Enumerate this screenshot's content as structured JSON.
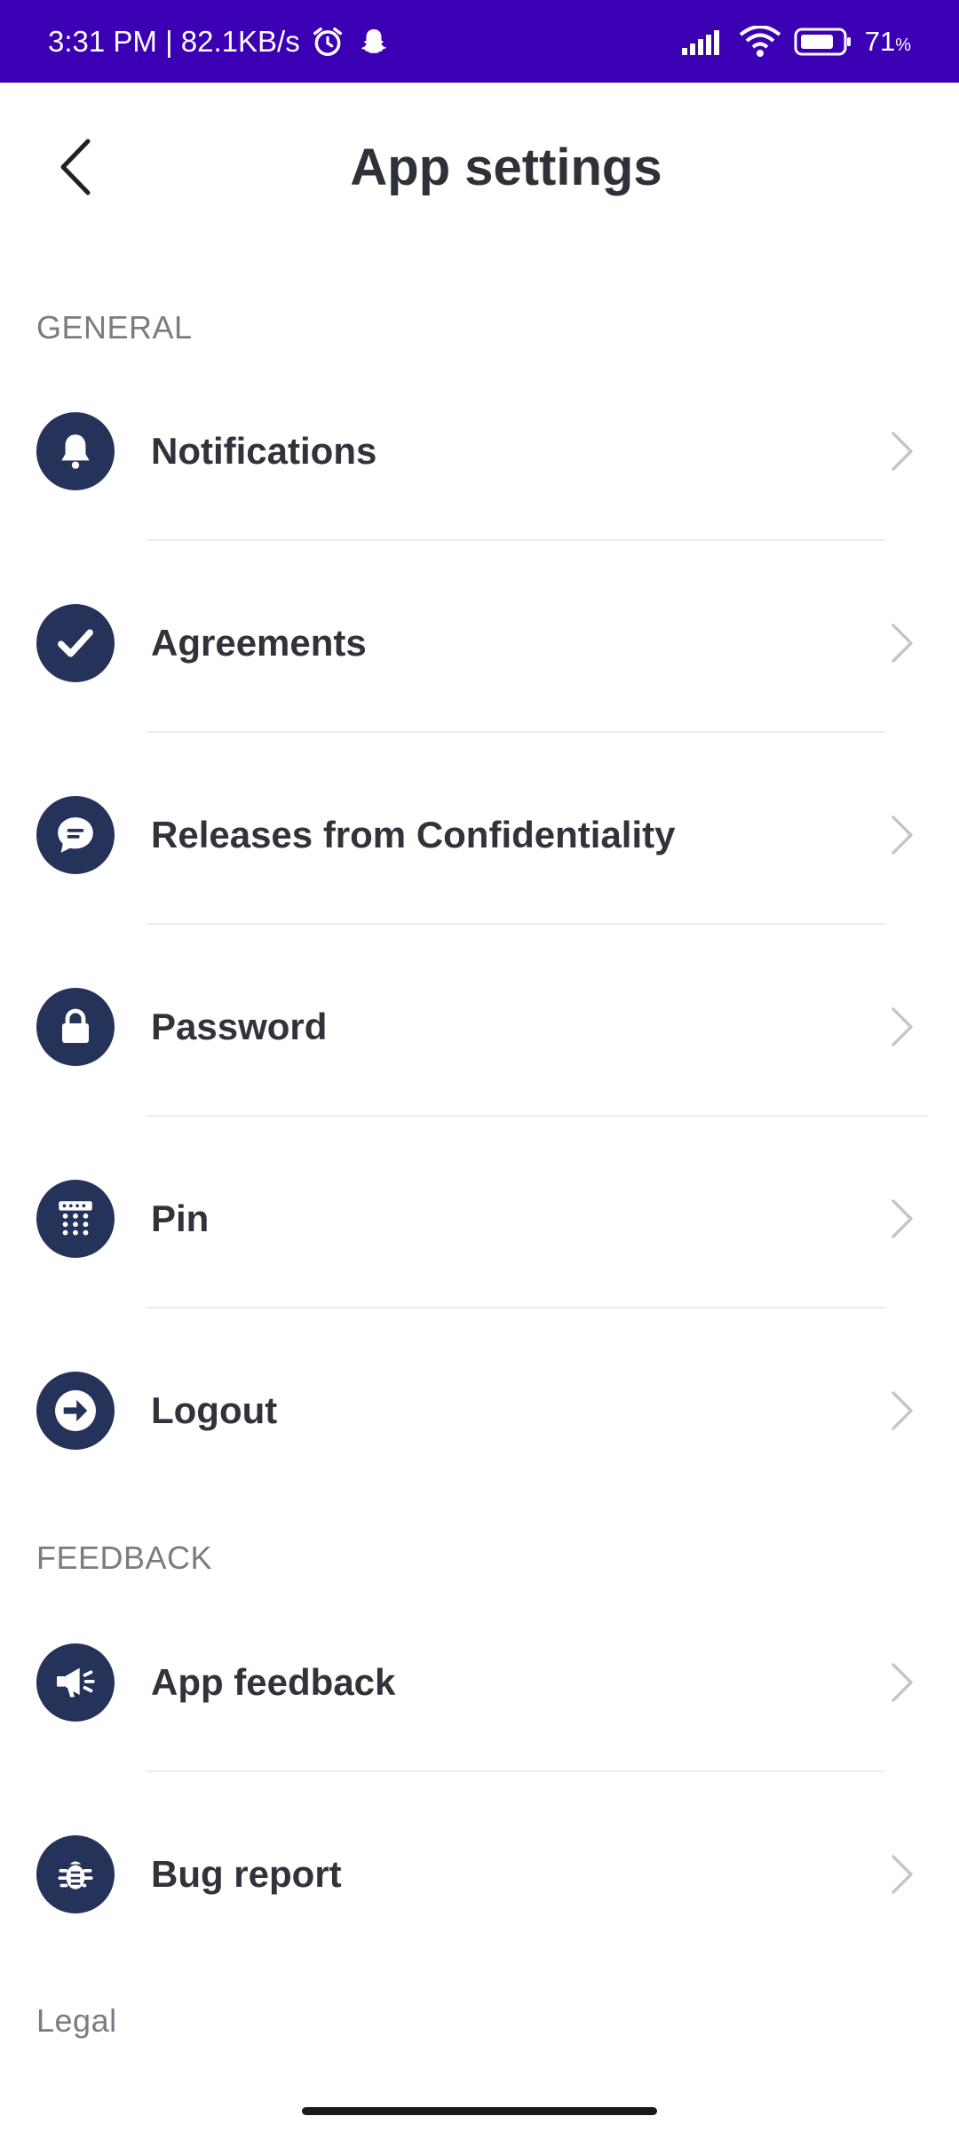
{
  "status_bar": {
    "time_speed": "3:31 PM | 82.1KB/s",
    "icons": [
      "alarm-icon",
      "snapchat-icon",
      "signal-icon",
      "wifi-icon",
      "battery-icon"
    ],
    "battery": "71",
    "battery_unit": "%",
    "background": "#3b00b4"
  },
  "header": {
    "title": "App settings",
    "back_icon": "chevron-left-icon"
  },
  "sections": {
    "general": {
      "label": "GENERAL",
      "items": [
        {
          "label": "Notifications",
          "icon": "bell-icon"
        },
        {
          "label": "Agreements",
          "icon": "check-circle-icon"
        },
        {
          "label": "Releases from Confidentiality",
          "icon": "chat-bubble-icon"
        },
        {
          "label": "Password",
          "icon": "lock-icon"
        },
        {
          "label": "Pin",
          "icon": "keypad-icon"
        },
        {
          "label": "Logout",
          "icon": "logout-arrow-icon"
        }
      ]
    },
    "feedback": {
      "label": "FEEDBACK",
      "items": [
        {
          "label": "App feedback",
          "icon": "megaphone-icon"
        },
        {
          "label": "Bug report",
          "icon": "bug-icon"
        }
      ]
    },
    "legal": {
      "label": "Legal"
    }
  },
  "colors": {
    "icon_bg": "#25325a",
    "text": "#31333a",
    "muted": "#7a7c83",
    "chevron": "#c5c6cb"
  }
}
